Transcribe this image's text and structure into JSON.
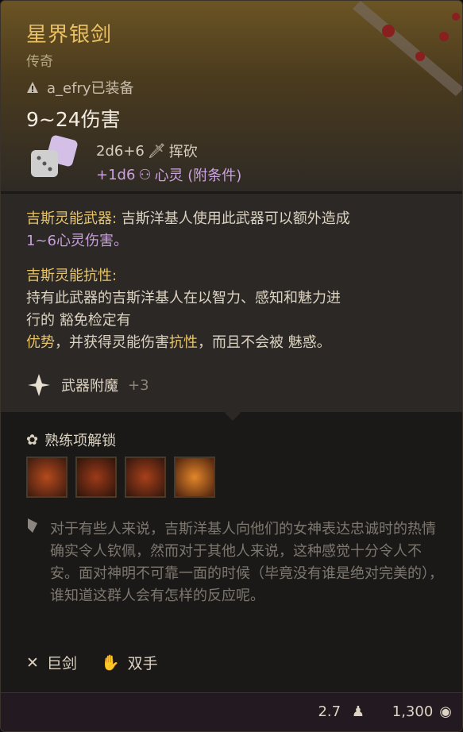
{
  "item": {
    "name": "星界银剑",
    "rarity": "传奇",
    "equipped_by": "a_efry已装备",
    "damage": "9~24伤害",
    "damage_line1": "2d6+6",
    "damage_type1": "挥砍",
    "damage_line2": "+1d6",
    "damage_type2": "心灵 (附条件)"
  },
  "description": {
    "p1_label": "吉斯灵能武器:",
    "p1_text": " 吉斯洋基人使用此武器可以额外造成",
    "p1_line2": "1~6心灵伤害。",
    "p2_label": "吉斯灵能抗性:",
    "p2_line1": "持有此武器的吉斯洋基人在以智力、感知和魅力进",
    "p2_line2": "行的 豁免检定有",
    "p2_line3a": "优势",
    "p2_line3b": "，并获得灵能伤害",
    "p2_line3c": "抗性",
    "p2_line3d": "，而且不会被 魅惑。"
  },
  "enchant": {
    "label": "武器附魔",
    "value": "+3"
  },
  "proficiency": {
    "label": "熟练项解锁",
    "skills": [
      "skill-1",
      "skill-2",
      "skill-3",
      "skill-4"
    ]
  },
  "lore": "对于有些人来说，吉斯洋基人向他们的女神表达忠诚时的热情确实令人钦佩，然而对于其他人来说，这种感觉十分令人不安。面对神明不可靠一面的时候（毕竟没有谁是绝对完美的），谁知道这群人会有怎样的反应呢。",
  "tags": {
    "weapon_type": "巨剑",
    "handedness": "双手"
  },
  "footer": {
    "weight": "2.7",
    "price": "1,300"
  },
  "colors": {
    "title": "#e9c063",
    "psychic": "#c89fdb",
    "gold_text": "#e7c46a"
  }
}
